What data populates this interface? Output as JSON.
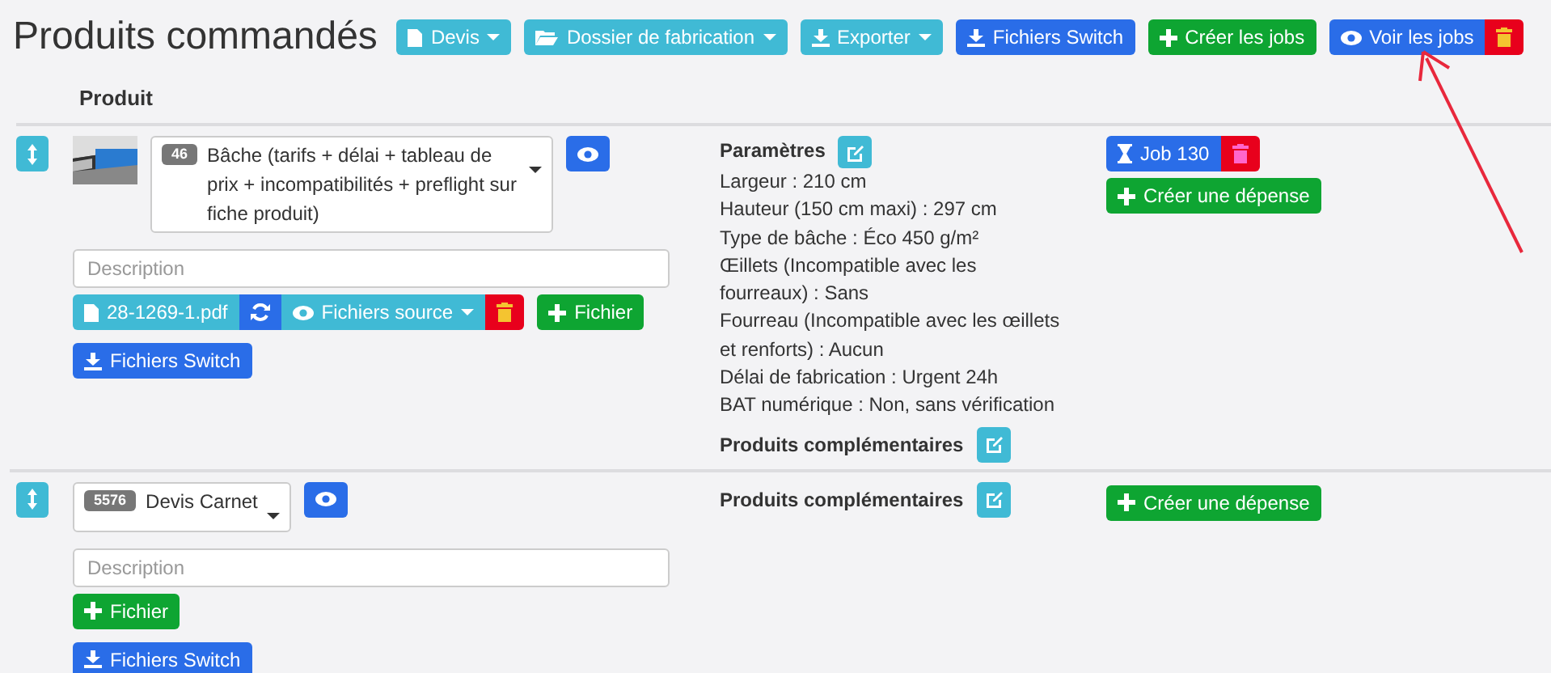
{
  "title": "Produits commandés",
  "toolbar": [
    {
      "kind": "dropdown",
      "label": "Devis",
      "color": "#40bad5"
    },
    {
      "kind": "dropdown",
      "label": "Dossier de fabrication",
      "color": "#40bad5"
    },
    {
      "kind": "dropdown",
      "label": "Exporter",
      "color": "#40bad5"
    },
    {
      "kind": "button",
      "label": "Fichiers Switch",
      "color": "#2a6de8"
    },
    {
      "kind": "button",
      "label": "Créer les jobs",
      "color": "#0ea532"
    },
    {
      "kind": "delete",
      "label": "Voir les jobs",
      "color": "#2a6de8"
    }
  ],
  "table": {
    "column_header": "Produit",
    "rows": [
      {
        "thumbnail": {
          "kind": "picture"
        },
        "code": "46",
        "product": "Bâche (tarifs + délai + tableau de prix + incompatibilités + preflight sur fiche produit)",
        "description_placeholder": "Description",
        "file": {
          "name": "28-1269-1.pdf",
          "source_label": "Fichiers source"
        },
        "add_file": "Fichier",
        "switch": "Fichiers Switch",
        "parameters": {
          "title": "Paramètres",
          "lines": [
            "Largeur : 210 cm",
            "Hauteur (150 cm maxi) : 297 cm",
            "Type de bâche : Éco 450 g/m²",
            "Œillets (Incompatible avec les fourreaux) : Sans",
            "Fourreau (Incompatible avec les œillets et renforts) : Aucun",
            "Délai de fabrication : Urgent 24h",
            "BAT numérique : Non, sans vérification"
          ]
        },
        "complementary": "Produits complémentaires",
        "jobs": [
          {
            "label": "Job 130"
          }
        ],
        "expense": "Créer une dépense"
      },
      {
        "code": "5576",
        "product": "Devis Carnet",
        "description_placeholder": "Description",
        "add_file": "Fichier",
        "switch": "Fichiers Switch",
        "complementary": "Produits complémentaires",
        "expense": "Créer une dépense"
      }
    ]
  }
}
